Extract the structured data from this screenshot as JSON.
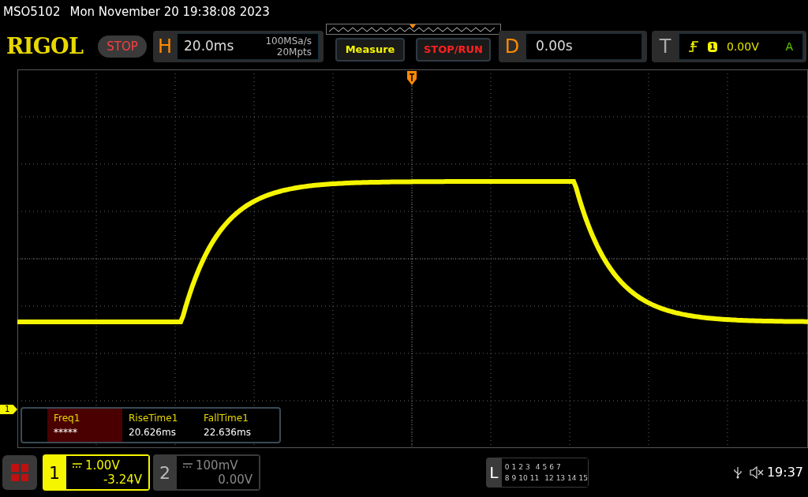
{
  "caption": {
    "model": "MSO5102",
    "datetime": "Mon November 20 19:38:08 2023"
  },
  "logo": "RIGOL",
  "run_state": {
    "label": "STOP"
  },
  "horizontal": {
    "letter": "H",
    "timebase": "20.0ms",
    "sample_rate": "100MSa/s",
    "memory": "20Mpts"
  },
  "buttons": [
    {
      "label": "Measure",
      "kind": "measure"
    },
    {
      "label": "STOP/RUN",
      "kind": "stoprun"
    }
  ],
  "delay": {
    "letter": "D",
    "value": "0.00s"
  },
  "trigger": {
    "letter": "T",
    "source": "1",
    "level": "0.00V",
    "mode": "A"
  },
  "channel_marker": "1",
  "measurements": [
    {
      "label": "Freq1",
      "value": "*****",
      "selected": true
    },
    {
      "label": "RiseTime1",
      "value": "20.626ms",
      "selected": false
    },
    {
      "label": "FallTime1",
      "value": "22.636ms",
      "selected": false
    }
  ],
  "channels": [
    {
      "number": "1",
      "scale": "1.00V",
      "offset": "-3.24V",
      "active": true
    },
    {
      "number": "2",
      "scale": "100mV",
      "offset": "0.00V",
      "active": false
    }
  ],
  "logic": {
    "letter": "L",
    "row_1": [
      "0",
      "1",
      "2",
      "3",
      "4",
      "5",
      "6",
      "7"
    ],
    "row_2": [
      "8",
      "9",
      "10",
      "11",
      "12",
      "13",
      "14",
      "15"
    ]
  },
  "status": {
    "time": "19:37"
  }
}
